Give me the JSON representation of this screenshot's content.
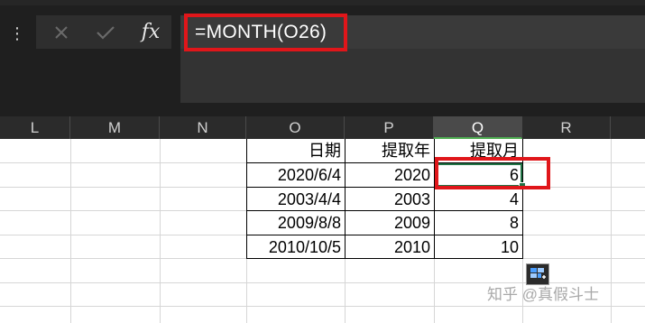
{
  "formula_bar": {
    "menu_glyph": "⋮",
    "fx_label": "fx",
    "formula": "=MONTH(O26)"
  },
  "columns": [
    "L",
    "M",
    "N",
    "O",
    "P",
    "Q",
    "R"
  ],
  "active_column": "Q",
  "table": {
    "headers": [
      "日期",
      "提取年",
      "提取月"
    ],
    "rows": [
      [
        "2020/6/4",
        "2020",
        "6"
      ],
      [
        "2003/4/4",
        "2003",
        "4"
      ],
      [
        "2009/8/8",
        "2009",
        "8"
      ],
      [
        "2010/10/5",
        "2010",
        "10"
      ]
    ]
  },
  "watermark": "知乎 @真假斗士",
  "colors": {
    "highlight": "#e0161a",
    "selection": "#217346",
    "dark_bg": "#1f1f1f"
  },
  "icons": {
    "cancel": "close-icon",
    "enter": "check-icon",
    "quick_analysis": "quick-analysis-icon"
  }
}
